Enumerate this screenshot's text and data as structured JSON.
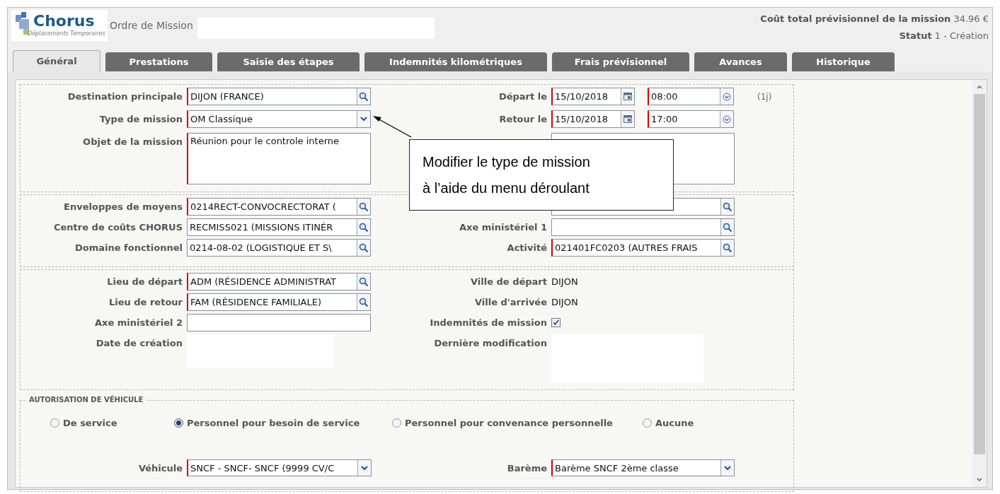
{
  "header": {
    "logo_name": "Chorus",
    "logo_tagline": "Déplacements Temporaires",
    "title": "Ordre de Mission",
    "cost_label": "Coût total prévisionnel de la mission",
    "cost_value": "34.96 €",
    "status_label": "Statut",
    "status_value": "1 - Création"
  },
  "tabs": [
    {
      "label": "Général",
      "selected": true
    },
    {
      "label": "Prestations",
      "selected": false
    },
    {
      "label": "Saisie des étapes",
      "selected": false
    },
    {
      "label": "Indemnités kilométriques",
      "selected": false
    },
    {
      "label": "Frais prévisionnel",
      "selected": false
    },
    {
      "label": "Avances",
      "selected": false
    },
    {
      "label": "Historique",
      "selected": false
    }
  ],
  "sections": [
    {
      "rows": [
        {
          "left": {
            "kind": "lookup",
            "label": "Destination principale",
            "value": "DIJON (FRANCE)",
            "required": true
          },
          "right": {
            "kind": "datetime",
            "label": "Départ le",
            "date": "15/10/2018",
            "time": "08:00",
            "required": true,
            "note": "(1j)"
          }
        },
        {
          "left": {
            "kind": "select",
            "label": "Type de mission",
            "value": "OM Classique",
            "required": true
          },
          "right": {
            "kind": "datetime",
            "label": "Retour le",
            "date": "15/10/2018",
            "time": "17:00",
            "required": true
          }
        },
        {
          "left": {
            "kind": "textarea",
            "label": "Objet de la mission",
            "value": "Réunion pour le controle interne",
            "required": true
          },
          "right": {
            "kind": "textarea",
            "required": false
          }
        }
      ]
    },
    {
      "rows": [
        {
          "left": {
            "kind": "lookup",
            "label": "Enveloppes de moyens",
            "value": "0214RECT-CONVOCRECTORAT (",
            "required": true
          },
          "right": {
            "kind": "lookup",
            "required": false
          }
        },
        {
          "left": {
            "kind": "lookup",
            "label": "Centre de coûts CHORUS",
            "value": "RECMISS021 (MISSIONS ITINÉR",
            "required": false
          },
          "right": {
            "kind": "lookup",
            "label": "Axe ministériel 1",
            "required": false
          }
        },
        {
          "left": {
            "kind": "lookup",
            "label": "Domaine fonctionnel",
            "value": "0214-08-02 (LOGISTIQUE ET S\\",
            "required": false
          },
          "right": {
            "kind": "lookup",
            "label": "Activité",
            "value": "021401FC0203 (AUTRES FRAIS",
            "required": true
          }
        }
      ]
    },
    {
      "rows": [
        {
          "left": {
            "kind": "lookup",
            "label": "Lieu de départ",
            "value": "ADM (RÉSIDENCE ADMINISTRAT",
            "required": true
          },
          "right": {
            "kind": "static",
            "label": "Ville de départ",
            "value": "DIJON"
          }
        },
        {
          "left": {
            "kind": "lookup",
            "label": "Lieu de retour",
            "value": "FAM (RÉSIDENCE FAMILIALE)",
            "required": true
          },
          "right": {
            "kind": "static",
            "label": "Ville d'arrivée",
            "value": "DIJON"
          }
        },
        {
          "left": {
            "kind": "text",
            "label": "Axe ministériel 2",
            "required": false
          },
          "right": {
            "kind": "checkbox",
            "label": "Indemnités de mission",
            "checked": true
          }
        },
        {
          "left": {
            "kind": "blank",
            "label": "Date de création"
          },
          "right": {
            "kind": "blank",
            "label": "Dernière modification"
          }
        }
      ]
    }
  ],
  "vehicle": {
    "legend": "AUTORISATION DE VÉHICULE",
    "options": [
      {
        "label": "De service",
        "selected": false
      },
      {
        "label": "Personnel pour besoin de service",
        "selected": true
      },
      {
        "label": "Personnel pour convenance personnelle",
        "selected": false
      },
      {
        "label": "Aucune",
        "selected": false
      }
    ],
    "vehicle_field": {
      "label": "Véhicule",
      "value": "SNCF - SNCF- SNCF (9999 CV/C",
      "required": true
    },
    "scale_field": {
      "label": "Barème",
      "value": "Barème SNCF 2ème classe",
      "required": true
    }
  },
  "callout": {
    "lines": [
      "Modifier le type de mission",
      "à l’aide du menu déroulant"
    ]
  }
}
